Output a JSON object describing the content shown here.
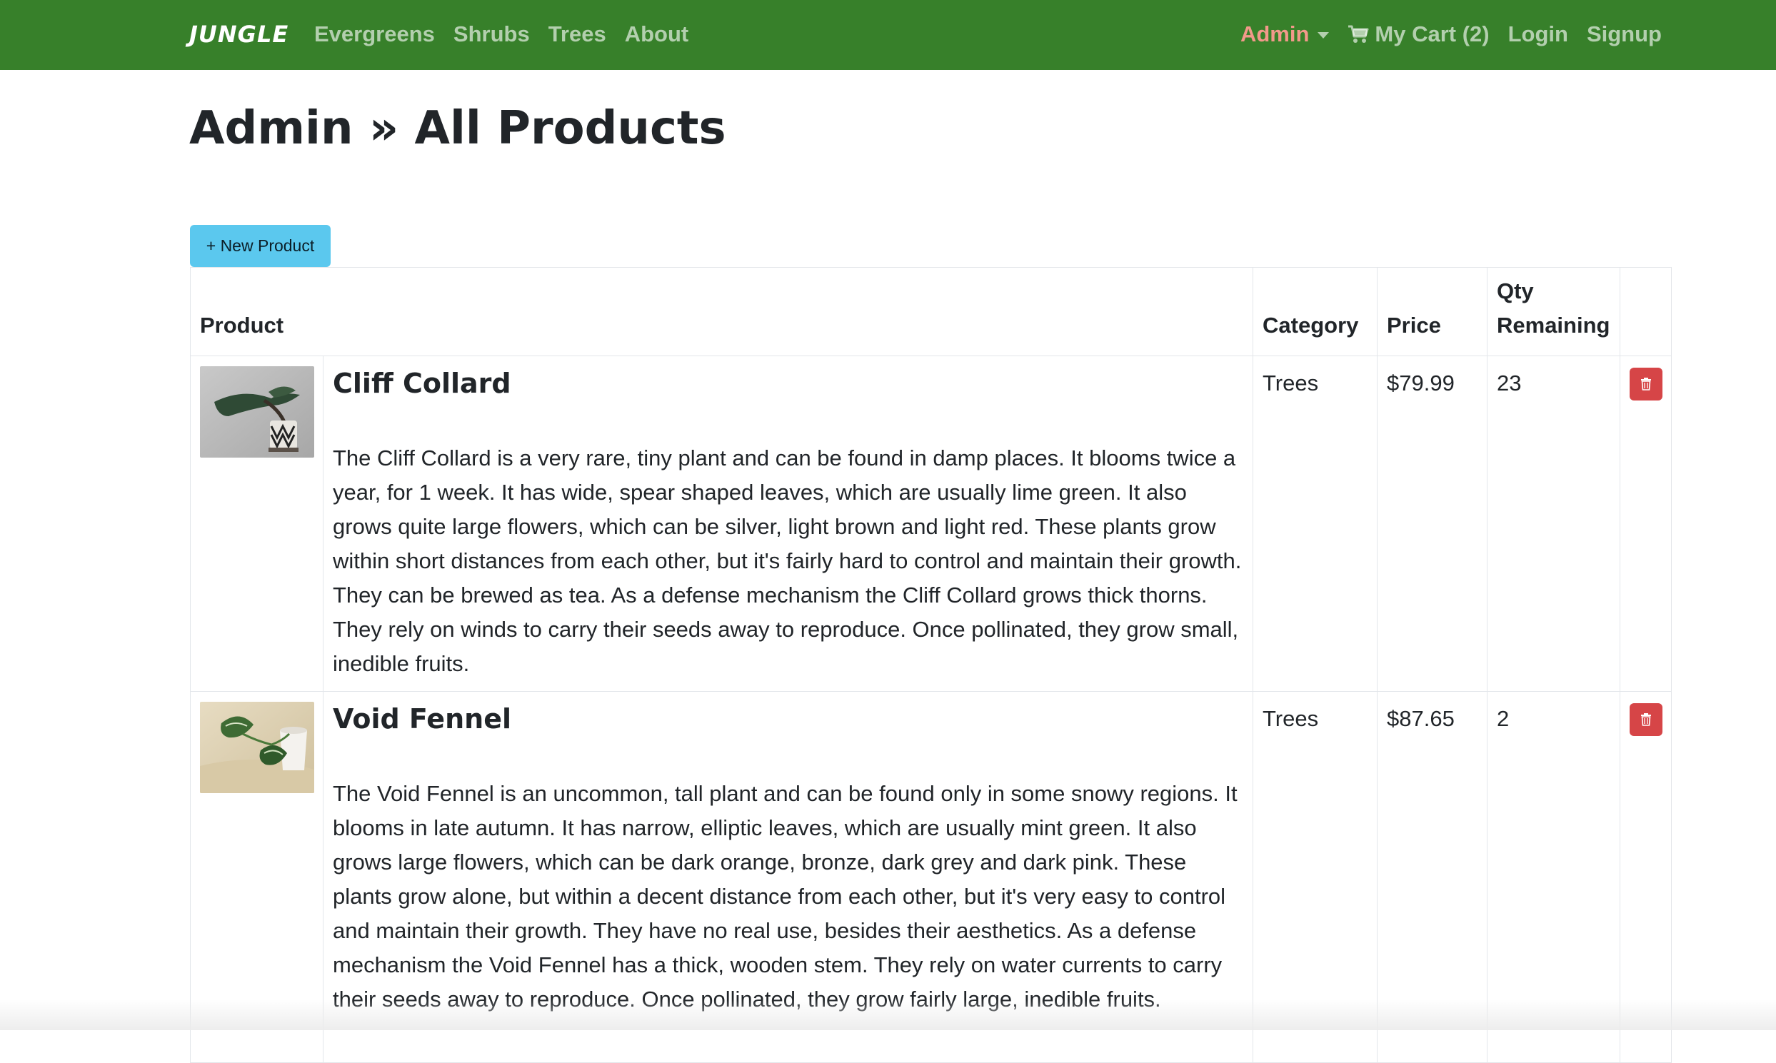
{
  "navbar": {
    "brand": "JUNGLE",
    "links": [
      "Evergreens",
      "Shrubs",
      "Trees",
      "About"
    ],
    "admin_label": "Admin",
    "cart_label": "My Cart (2)",
    "login_label": "Login",
    "signup_label": "Signup",
    "bg_color": "#37802a",
    "admin_color": "#f2998a"
  },
  "page": {
    "title": "Admin » All Products",
    "new_button_label": "+ New Product"
  },
  "table": {
    "headers": {
      "product": "Product",
      "category": "Category",
      "price": "Price",
      "qty": "Qty Remaining"
    },
    "rows": [
      {
        "name": "Cliff Collard",
        "description": "The Cliff Collard is a very rare, tiny plant and can be found in damp places. It blooms twice a year, for 1 week. It has wide, spear shaped leaves, which are usually lime green. It also grows quite large flowers, which can be silver, light brown and light red. These plants grow within short distances from each other, but it's fairly hard to control and maintain their growth. They can be brewed as tea. As a defense mechanism the Cliff Collard grows thick thorns. They rely on winds to carry their seeds away to reproduce. Once pollinated, they grow small, inedible fruits.",
        "category": "Trees",
        "price": "$79.99",
        "qty": "23",
        "image": "bonsai-tree-photo"
      },
      {
        "name": "Void Fennel",
        "description": "The Void Fennel is an uncommon, tall plant and can be found only in some snowy regions. It blooms in late autumn. It has narrow, elliptic leaves, which are usually mint green. It also grows large flowers, which can be dark orange, bronze, dark grey and dark pink. These plants grow alone, but within a decent distance from each other, but it's very easy to control and maintain their growth. They have no real use, besides their aesthetics. As a defense mechanism the Void Fennel has a thick, wooden stem. They rely on water currents to carry their seeds away to reproduce. Once pollinated, they grow fairly large, inedible fruits.",
        "category": "Trees",
        "price": "$87.65",
        "qty": "2",
        "image": "potted-leaf-plant-photo"
      }
    ],
    "delete_color": "#d64547"
  }
}
